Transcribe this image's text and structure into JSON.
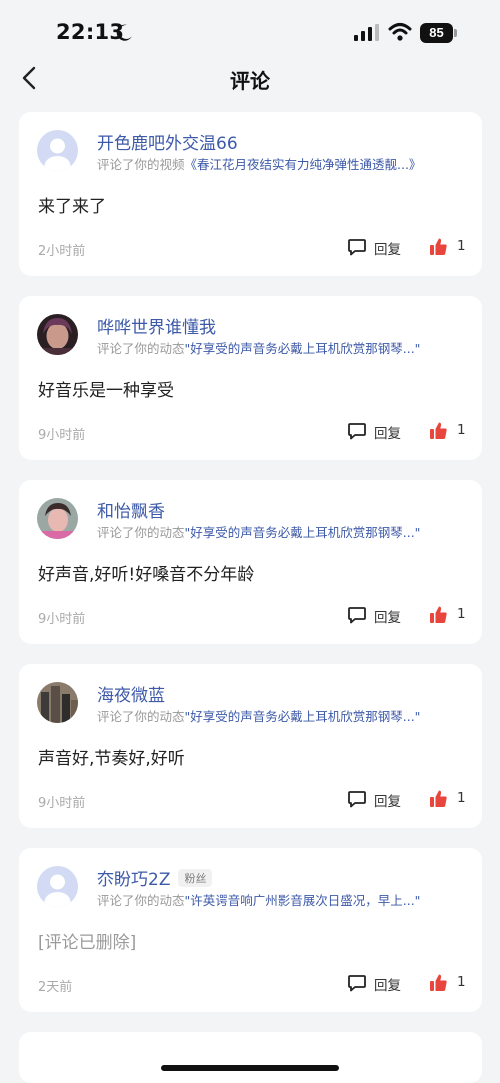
{
  "status_bar": {
    "time": "22:13",
    "battery": "85"
  },
  "nav": {
    "title": "评论"
  },
  "comments": [
    {
      "username": "开色鹿吧外交温66",
      "action_prefix": "评论了你的视频",
      "target": "《春江花月夜结实有力纯净弹性通透靓...》",
      "text": "来了来了",
      "time": "2小时前",
      "reply_label": "回复",
      "likes": "1",
      "avatar": "default"
    },
    {
      "username": "哗哗世界谁懂我",
      "action_prefix": "评论了你的动态",
      "target": "\"好享受的声音务必戴上耳机欣赏那钢琴...\"",
      "text": "好音乐是一种享受",
      "time": "9小时前",
      "reply_label": "回复",
      "likes": "1",
      "avatar": "photo-portrait-dark"
    },
    {
      "username": "和怡飘香",
      "action_prefix": "评论了你的动态",
      "target": "\"好享受的声音务必戴上耳机欣赏那钢琴...\"",
      "text": "好声音,好听!好嗓音不分年龄",
      "time": "9小时前",
      "reply_label": "回复",
      "likes": "1",
      "avatar": "photo-portrait-pink"
    },
    {
      "username": "海夜微蓝",
      "action_prefix": "评论了你的动态",
      "target": "\"好享受的声音务必戴上耳机欣赏那钢琴...\"",
      "text": "声音好,节奏好,好听",
      "time": "9小时前",
      "reply_label": "回复",
      "likes": "1",
      "avatar": "photo-buildings"
    },
    {
      "username": "夵盼巧2Z",
      "badge": "粉丝",
      "action_prefix": "评论了你的动态",
      "target": "\"许英谔音响广州影音展次日盛况，早上...\"",
      "text": "[评论已删除]",
      "time": "2天前",
      "reply_label": "回复",
      "likes": "1",
      "avatar": "default"
    }
  ],
  "colors": {
    "accent_blue": "#3d5aa9",
    "like_red": "#e8463c",
    "background": "#f3f4f6"
  }
}
